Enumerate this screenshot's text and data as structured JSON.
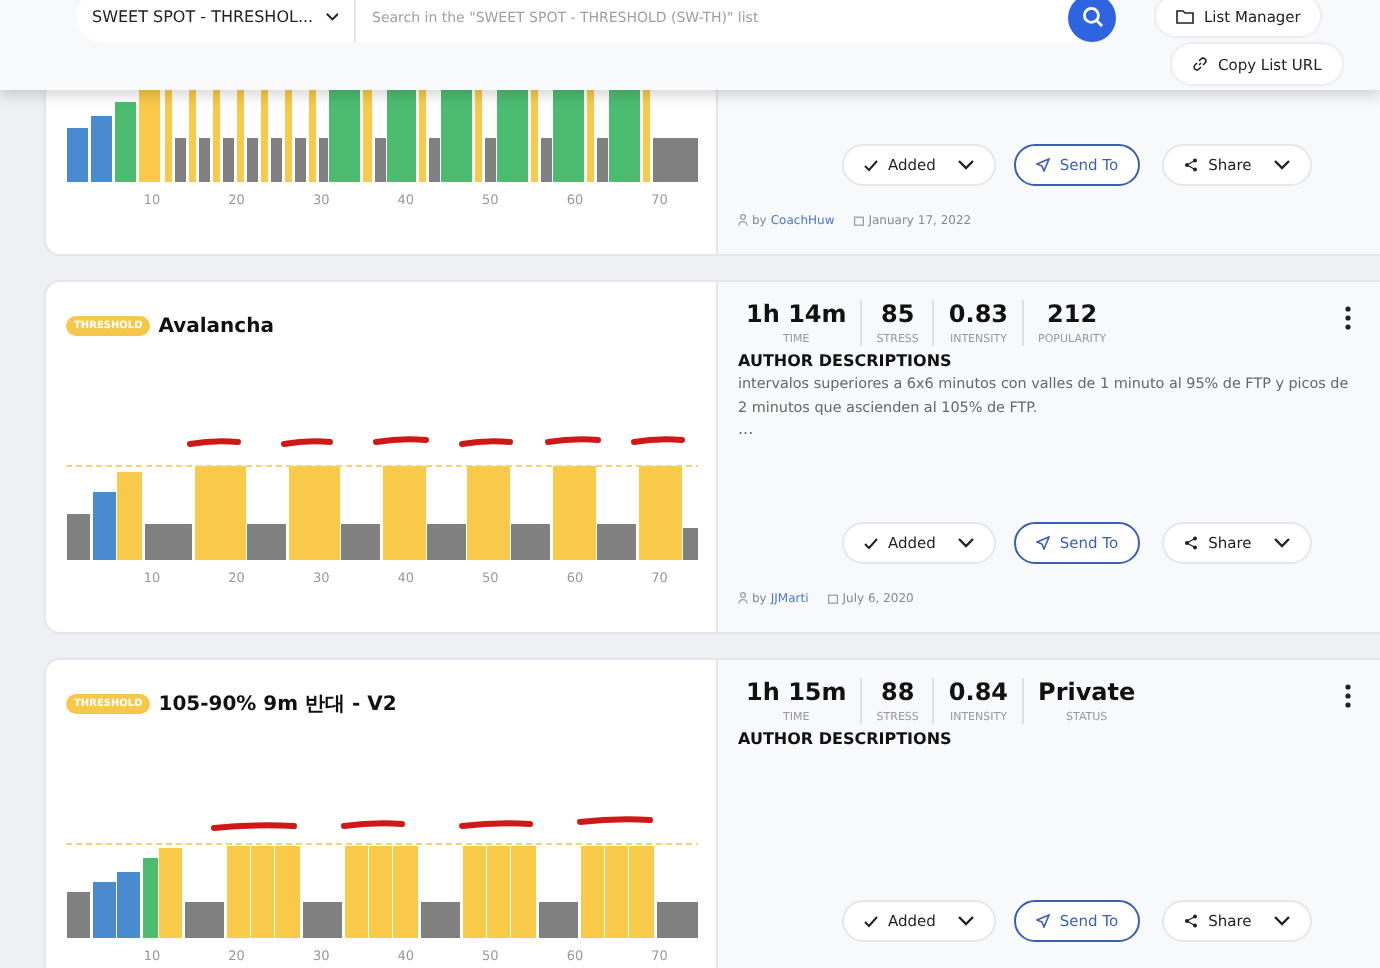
{
  "header": {
    "list_dropdown": {
      "value": "SWEET SPOT - THRESHOL..."
    },
    "search": {
      "placeholder": "Search in the \"SWEET SPOT - THRESHOLD (SW-TH)\" list"
    },
    "buttons": [
      "List Manager",
      "Copy List URL"
    ]
  },
  "workouts": [
    {
      "x_labels": [
        "10",
        "20",
        "30",
        "40",
        "50",
        "60",
        "70"
      ],
      "actions": {
        "added": "Added",
        "send": "Send To",
        "share": "Share"
      },
      "author_prefix": "by",
      "author": "CoachHuw",
      "date": "January 17, 2022"
    },
    {
      "badge": "THRESHOLD",
      "name": "Avalancha",
      "x_labels": [
        "10",
        "20",
        "30",
        "40",
        "50",
        "60",
        "70"
      ],
      "stats": [
        {
          "value": "1h 14m",
          "label": "TIME"
        },
        {
          "value": "85",
          "label": "STRESS"
        },
        {
          "value": "0.83",
          "label": "INTENSITY"
        },
        {
          "value": "212",
          "label": "POPULARITY"
        }
      ],
      "description_heading": "AUTHOR DESCRIPTIONS",
      "description": "intervalos superiores a 6x6 minutos con valles de 1 minuto al 95% de FTP y picos de 2 minutos que ascienden al 105% de FTP.",
      "more": "...",
      "actions": {
        "added": "Added",
        "send": "Send To",
        "share": "Share"
      },
      "author_prefix": "by",
      "author": "JJMarti",
      "date": "July 6, 2020"
    },
    {
      "badge": "THRESHOLD",
      "name": "105-90% 9m 반대 - V2",
      "x_labels": [
        "10",
        "20",
        "30",
        "40",
        "50",
        "60",
        "70"
      ],
      "stats": [
        {
          "value": "1h 15m",
          "label": "TIME"
        },
        {
          "value": "88",
          "label": "STRESS"
        },
        {
          "value": "0.84",
          "label": "INTENSITY"
        },
        {
          "value": "Private",
          "label": "STATUS"
        }
      ],
      "description_heading": "AUTHOR DESCRIPTIONS",
      "actions": {
        "added": "Added",
        "send": "Send To",
        "share": "Share"
      }
    }
  ]
}
